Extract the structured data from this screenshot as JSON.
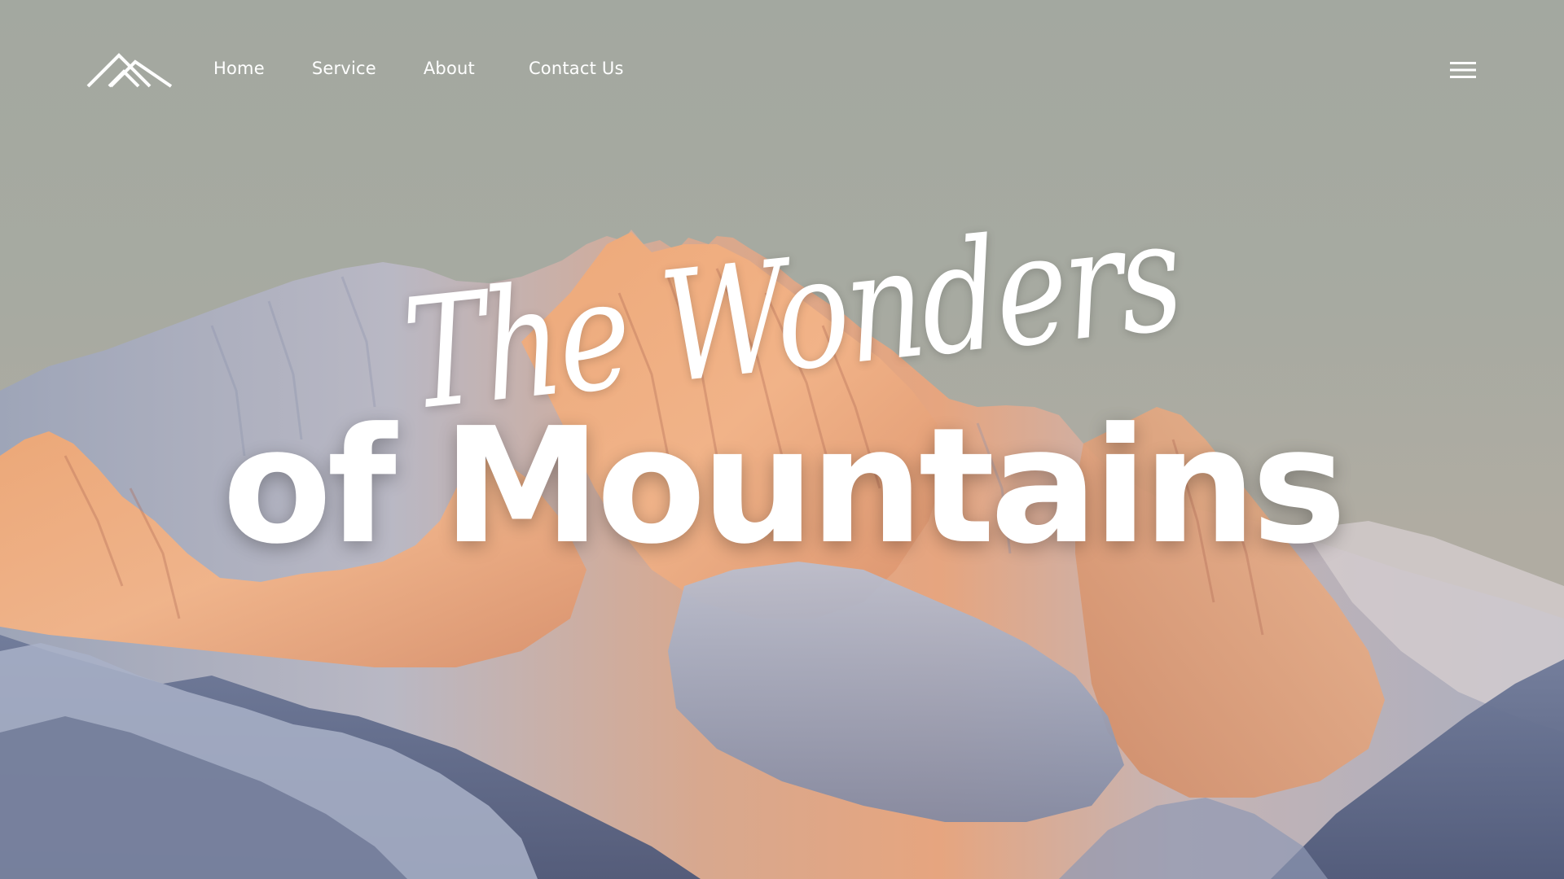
{
  "header": {
    "logo_icon": "mountain-peaks-logo-icon",
    "menu_icon": "hamburger-menu-icon"
  },
  "nav": {
    "items": [
      {
        "label": "Home"
      },
      {
        "label": "Service"
      },
      {
        "label": "About"
      },
      {
        "label": "Contact Us"
      }
    ]
  },
  "hero": {
    "script_title": "The Wonders",
    "bold_title": "of Mountains",
    "background_image": "snowy-mountain-range-at-sunrise"
  },
  "colors": {
    "text": "#ffffff",
    "sky": "#a4aaa2",
    "peak_glow": "#f2a36f",
    "snow_shadow": "#9aa5bd"
  }
}
